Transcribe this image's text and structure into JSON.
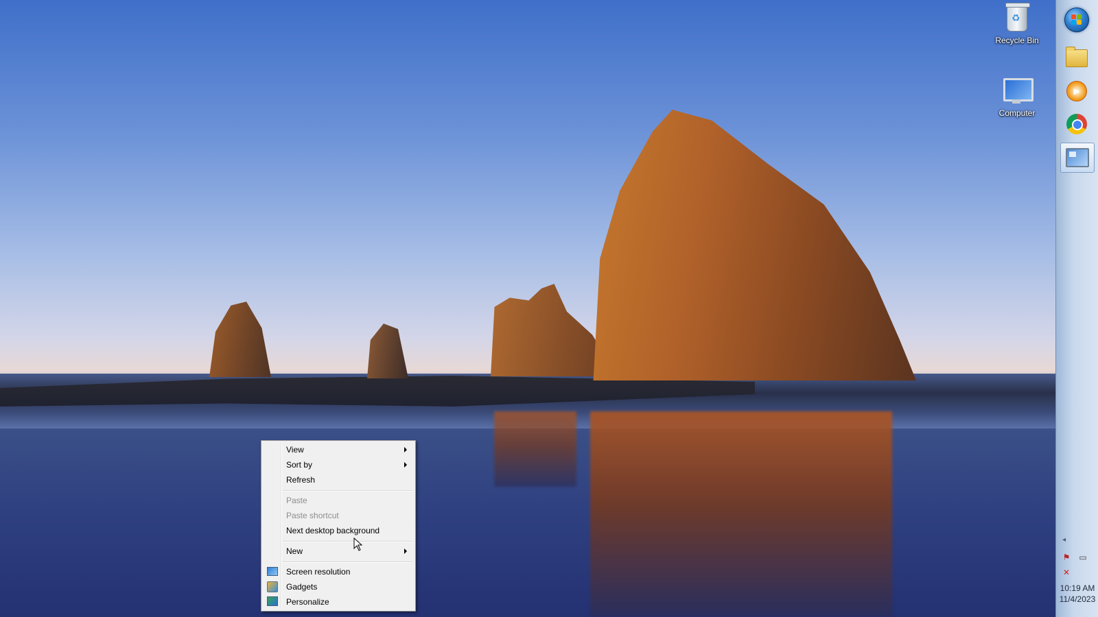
{
  "desktop": {
    "icons": [
      {
        "label": "Recycle Bin",
        "icon": "recycle-bin-icon"
      },
      {
        "label": "Computer",
        "icon": "computer-icon"
      }
    ]
  },
  "taskbar": {
    "buttons": [
      {
        "name": "start",
        "icon": "windows-start-orb-icon"
      },
      {
        "name": "explorer",
        "icon": "folder-icon"
      },
      {
        "name": "media-player",
        "icon": "media-player-icon"
      },
      {
        "name": "chrome",
        "icon": "chrome-icon"
      },
      {
        "name": "remote-desktop",
        "icon": "remote-desktop-icon",
        "active": true
      }
    ],
    "tray": {
      "chevron": "◂",
      "icons": [
        "action-center-flag-icon",
        "network-icon",
        "volume-muted-icon"
      ],
      "time": "10:19 AM",
      "date": "11/4/2023"
    }
  },
  "context_menu": {
    "items": [
      {
        "label": "View",
        "submenu": true,
        "enabled": true
      },
      {
        "label": "Sort by",
        "submenu": true,
        "enabled": true
      },
      {
        "label": "Refresh",
        "submenu": false,
        "enabled": true
      },
      {
        "label": "Paste",
        "submenu": false,
        "enabled": false
      },
      {
        "label": "Paste shortcut",
        "submenu": false,
        "enabled": false
      },
      {
        "label": "Next desktop background",
        "submenu": false,
        "enabled": true
      },
      {
        "label": "New",
        "submenu": true,
        "enabled": true
      },
      {
        "label": "Screen resolution",
        "submenu": false,
        "enabled": true,
        "icon": "screen-resolution-icon"
      },
      {
        "label": "Gadgets",
        "submenu": false,
        "enabled": true,
        "icon": "gadgets-icon"
      },
      {
        "label": "Personalize",
        "submenu": false,
        "enabled": true,
        "icon": "personalize-icon"
      }
    ]
  },
  "colors": {
    "menu_bg": "#f0f0f0",
    "menu_disabled_text": "#8d8d8d",
    "taskbar_bg": "#c8d8ec"
  }
}
